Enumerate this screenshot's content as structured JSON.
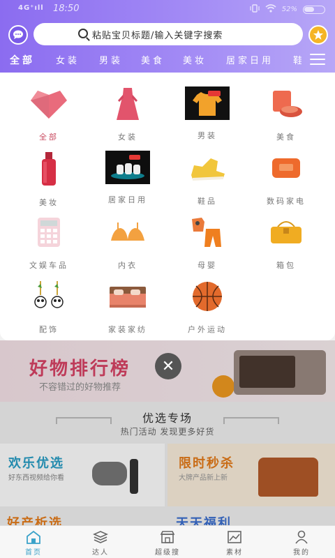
{
  "status_bar": {
    "signal": "4G⁺ıll",
    "time": "18:50",
    "battery_percent": "52%"
  },
  "search": {
    "placeholder": "粘贴宝贝标题/输入关键字搜索"
  },
  "tabs": [
    {
      "label": "全部",
      "active": true
    },
    {
      "label": "女装",
      "active": false
    },
    {
      "label": "男装",
      "active": false
    },
    {
      "label": "美食",
      "active": false
    },
    {
      "label": "美妆",
      "active": false
    },
    {
      "label": "居家日用",
      "active": false
    },
    {
      "label": "鞋",
      "active": false
    }
  ],
  "categories": [
    {
      "label": "全部",
      "icon": "heart-gem-icon",
      "active": true
    },
    {
      "label": "女装",
      "icon": "dress-icon"
    },
    {
      "label": "男装",
      "icon": "tshirt-icon"
    },
    {
      "label": "美食",
      "icon": "food-icon"
    },
    {
      "label": "美妆",
      "icon": "cosmetics-bottle-icon"
    },
    {
      "label": "居家日用",
      "icon": "tea-set-icon"
    },
    {
      "label": "鞋品",
      "icon": "sneaker-icon"
    },
    {
      "label": "数码家电",
      "icon": "speaker-icon"
    },
    {
      "label": "文娱车品",
      "icon": "calculator-icon"
    },
    {
      "label": "内衣",
      "icon": "bra-icon"
    },
    {
      "label": "母婴",
      "icon": "kids-clothes-icon"
    },
    {
      "label": "箱包",
      "icon": "handbag-icon"
    },
    {
      "label": "配饰",
      "icon": "panda-earrings-icon"
    },
    {
      "label": "家装家纺",
      "icon": "bed-icon"
    },
    {
      "label": "户外运动",
      "icon": "basketball-icon"
    }
  ],
  "ranking_banner": {
    "title": "好物排行榜",
    "subtitle": "不容错过的好物推荐"
  },
  "featured": {
    "title": "优选专场",
    "subtitle": "热门活动 发现更多好货"
  },
  "cards": {
    "left_title": "欢乐优选",
    "left_sub": "好东西视频给你看",
    "right_title": "限时秒杀",
    "right_sub": "大牌产品新上新",
    "bottom_left_title": "好产析选",
    "bottom_right_title": "天天福利"
  },
  "bottom_nav": [
    {
      "label": "首页",
      "icon": "home-icon",
      "active": true
    },
    {
      "label": "达人",
      "icon": "layers-icon"
    },
    {
      "label": "超级搜",
      "icon": "store-icon"
    },
    {
      "label": "素材",
      "icon": "chart-image-icon"
    },
    {
      "label": "我的",
      "icon": "person-icon"
    }
  ],
  "colors": {
    "header_start": "#8b6cf0",
    "accent_active": "#c94b60",
    "nav_active": "#3aa2c9"
  }
}
